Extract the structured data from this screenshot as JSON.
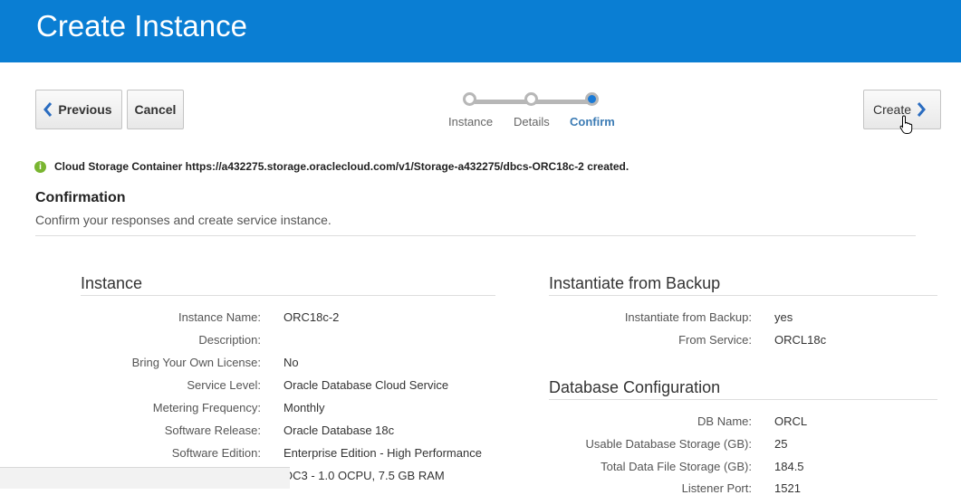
{
  "header": {
    "title": "Create Instance"
  },
  "toolbar": {
    "previous_label": "Previous",
    "cancel_label": "Cancel",
    "create_label": "Create"
  },
  "train": {
    "steps": [
      {
        "label": "Instance",
        "state": "visited"
      },
      {
        "label": "Details",
        "state": "visited"
      },
      {
        "label": "Confirm",
        "state": "current"
      }
    ]
  },
  "message": {
    "icon": "info-icon",
    "text": "Cloud Storage Container https://a432275.storage.oraclecloud.com/v1/Storage-a432275/dbcs-ORC18c-2 created."
  },
  "confirmation": {
    "title": "Confirmation",
    "subtitle": "Confirm your responses and create service instance."
  },
  "instance": {
    "title": "Instance",
    "rows": [
      {
        "label": "Instance Name:",
        "value": "ORC18c-2"
      },
      {
        "label": "Description:",
        "value": ""
      },
      {
        "label": "Bring Your Own License:",
        "value": "No"
      },
      {
        "label": "Service Level:",
        "value": "Oracle Database Cloud Service"
      },
      {
        "label": "Metering Frequency:",
        "value": "Monthly"
      },
      {
        "label": "Software Release:",
        "value": "Oracle Database 18c"
      },
      {
        "label": "Software Edition:",
        "value": "Enterprise Edition - High Performance"
      },
      {
        "label": "",
        "value": "OC3 - 1.0 OCPU, 7.5 GB RAM"
      }
    ]
  },
  "backup": {
    "title": "Instantiate from Backup",
    "rows": [
      {
        "label": "Instantiate from Backup:",
        "value": "yes"
      },
      {
        "label": "From Service:",
        "value": "ORCL18c"
      }
    ]
  },
  "dbconfig": {
    "title": "Database Configuration",
    "rows": [
      {
        "label": "DB Name:",
        "value": "ORCL"
      },
      {
        "label": "Usable Database Storage (GB):",
        "value": "25"
      },
      {
        "label": "Total Data File Storage (GB):",
        "value": "184.5"
      },
      {
        "label": "Listener Port:",
        "value": "1521"
      }
    ]
  },
  "colors": {
    "header_bg": "#0a7ed3",
    "accent": "#1a7ad6",
    "info": "#79b530"
  }
}
